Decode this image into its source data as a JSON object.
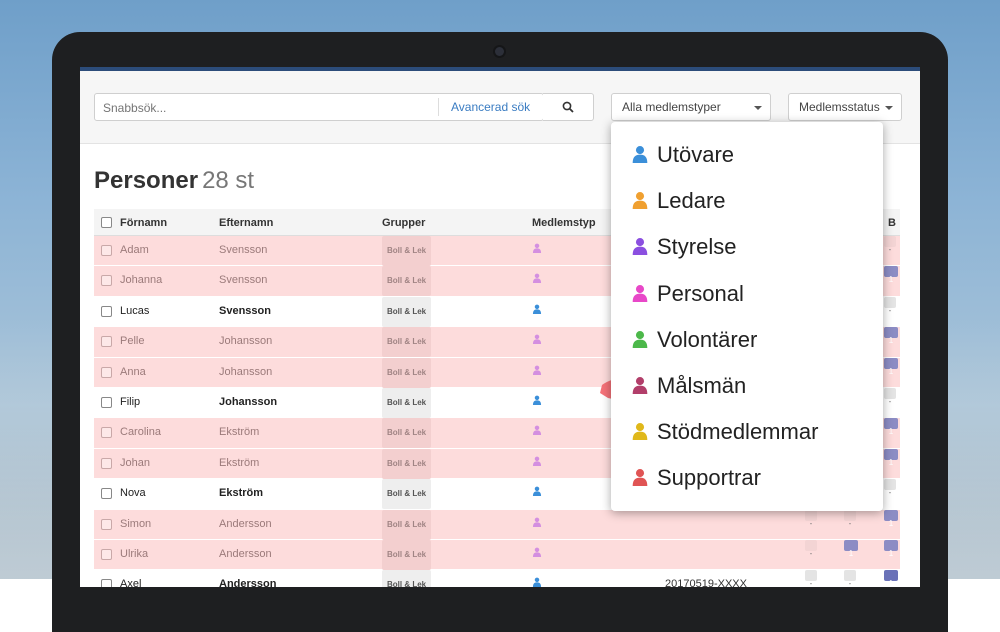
{
  "toolbar": {
    "search_placeholder": "Snabbsök...",
    "advanced_search": "Avancerad sök",
    "member_types_dropdown": "Alla medlemstyper",
    "member_status_dropdown": "Medlemsstatus"
  },
  "page": {
    "title": "Personer",
    "count": "28 st"
  },
  "table": {
    "headers": [
      "Förnamn",
      "Efternamn",
      "Grupper",
      "Medlemstyp",
      "B"
    ],
    "rows": [
      {
        "first": "Adam",
        "last": "Svensson",
        "group": "Boll & Lek",
        "style": "pink",
        "b": "-"
      },
      {
        "first": "Johanna",
        "last": "Svensson",
        "group": "Boll & Lek",
        "style": "pink",
        "b": "1"
      },
      {
        "first": "Lucas",
        "last": "Svensson",
        "group": "Boll & Lek",
        "style": "white",
        "b": "-"
      },
      {
        "first": "Pelle",
        "last": "Johansson",
        "group": "Boll & Lek",
        "style": "pink",
        "b": "1"
      },
      {
        "first": "Anna",
        "last": "Johansson",
        "group": "Boll & Lek",
        "style": "pink",
        "b": "1"
      },
      {
        "first": "Filip",
        "last": "Johansson",
        "group": "Boll & Lek",
        "style": "white",
        "b": "-"
      },
      {
        "first": "Carolina",
        "last": "Ekström",
        "group": "Boll & Lek",
        "style": "pink",
        "b": "1"
      },
      {
        "first": "Johan",
        "last": "Ekström",
        "group": "Boll & Lek",
        "style": "pink",
        "b": "1"
      },
      {
        "first": "Nova",
        "last": "Ekström",
        "group": "Boll & Lek",
        "style": "white",
        "b": "-"
      },
      {
        "first": "Simon",
        "last": "Andersson",
        "group": "Boll & Lek",
        "style": "pink",
        "b": "1",
        "c1": "-",
        "c2": "-"
      },
      {
        "first": "Ulrika",
        "last": "Andersson",
        "group": "Boll & Lek",
        "style": "pink",
        "b": "1",
        "c1": "-",
        "c2": "1"
      },
      {
        "first": "Axel",
        "last": "Andersson",
        "group": "Boll & Lek",
        "style": "white",
        "b": "1",
        "c1": "-",
        "c2": "-",
        "pnr": "20170519-XXXX"
      }
    ]
  },
  "menu": {
    "items": [
      {
        "label": "Utövare",
        "color": "#3b8fd9"
      },
      {
        "label": "Ledare",
        "color": "#f0a030"
      },
      {
        "label": "Styrelse",
        "color": "#8b4fe0"
      },
      {
        "label": "Personal",
        "color": "#e848c8"
      },
      {
        "label": "Volontärer",
        "color": "#4cb84a"
      },
      {
        "label": "Målsmän",
        "color": "#b23e6a",
        "highlighted": true
      },
      {
        "label": "Stödmedlemmar",
        "color": "#e0b81a"
      },
      {
        "label": "Supportrar",
        "color": "#e05454"
      }
    ]
  },
  "colors": {
    "member_icon_pink": "#d48fe0",
    "member_icon_blue": "#3b8fd9",
    "highlight": "#f46a72"
  }
}
